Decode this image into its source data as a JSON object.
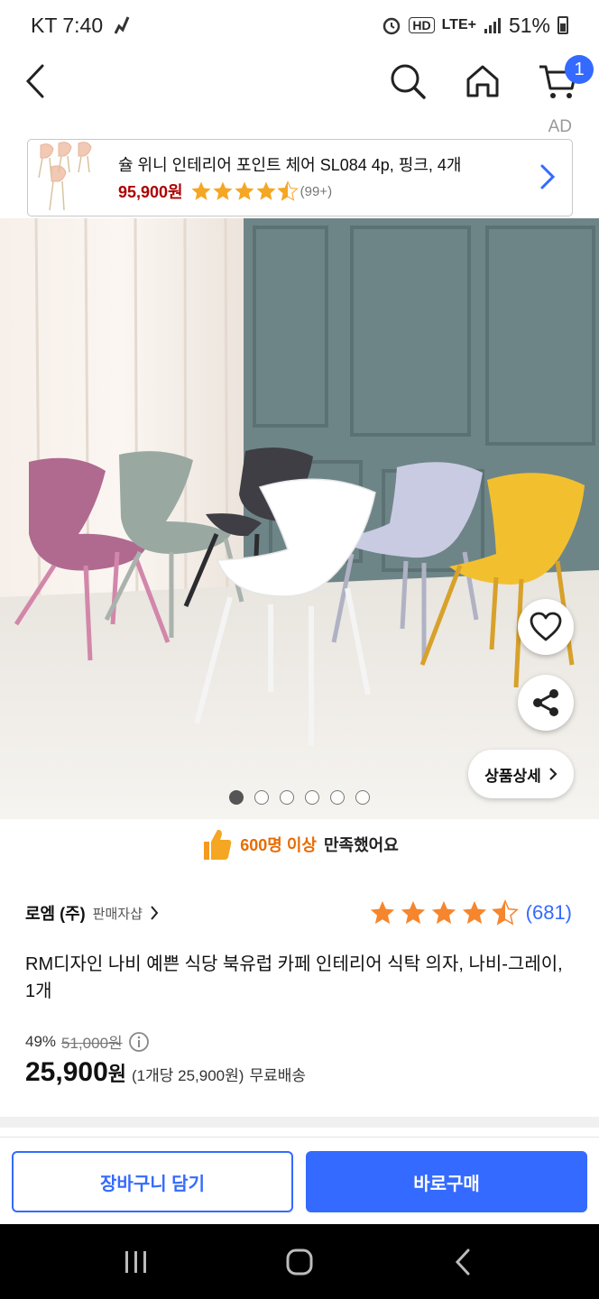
{
  "status_bar": {
    "carrier_time": "KT 7:40",
    "hd": "HD",
    "network": "LTE+",
    "battery": "51%"
  },
  "header": {
    "back_icon": "chevron-left-icon",
    "search_icon": "search-icon",
    "home_icon": "home-icon",
    "cart_icon": "cart-icon",
    "cart_count": "1"
  },
  "ad": {
    "label": "AD",
    "title": "슐 위니 인테리어 포인트 체어 SL084 4p, 핑크, 4개",
    "price": "95,900원",
    "rating": 4.5,
    "review_count": "(99+)"
  },
  "hero": {
    "current_slide": 1,
    "total_slides": 6,
    "detail_button": "상품상세",
    "colors": {
      "wall": "#6e8588",
      "chair_pink": "#b06a90",
      "chair_sage": "#9aa8a2",
      "chair_charcoal": "#3e3e44",
      "chair_white": "#ffffff",
      "chair_lavender": "#c9cbe2",
      "chair_yellow": "#f2c02e"
    }
  },
  "satisfaction": {
    "highlight": "600명 이상",
    "rest": "만족했어요"
  },
  "seller": {
    "name": "로엠 (주)",
    "type": "판매자샵"
  },
  "rating": {
    "value": 4.5,
    "count": "(681)"
  },
  "product": {
    "title": "RM디자인 나비 예쁜 식당 북유럽 카페 인테리어 식탁 의자, 나비-그레이, 1개",
    "discount": "49%",
    "original_price": "51,000원",
    "price": "25,900",
    "price_unit": "원",
    "unit_price": "(1개당 25,900원)",
    "shipping": "무료배송"
  },
  "actions": {
    "add_to_cart": "장바구니 담기",
    "buy_now": "바로구매"
  },
  "accent_colors": {
    "primary": "#346aff",
    "price_red": "#ae0000",
    "star": "#f5a623",
    "satisfaction": "#e86c00"
  }
}
